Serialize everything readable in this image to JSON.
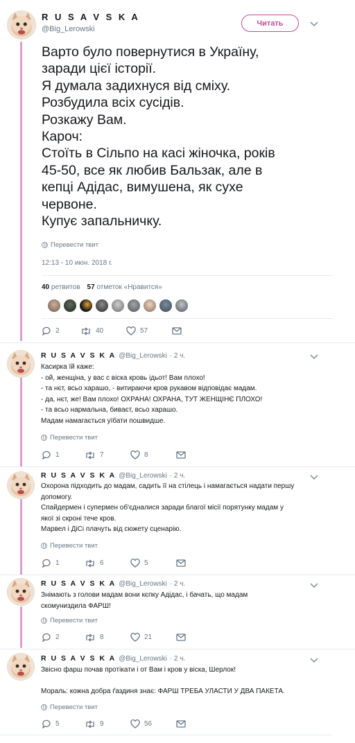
{
  "main": {
    "name": "R U S A V S K A",
    "handle": "@Big_Lerowski",
    "follow_label": "Читать",
    "lines": [
      "Варто було повернутися в Україну,",
      "заради цієї історії.",
      "Я думала задихнуся від сміху.",
      "Розбудила всіх сусідів.",
      "Розкажу Вам.",
      "Кароч:",
      "Стоїть в Сільпо на касі жіночка, років",
      "45-50, все як любив Бальзак, але в",
      "кепці Адідас, вимушена, як сухе",
      "червоне.",
      "Купує запальничку."
    ],
    "translate_label": "Перевести твит",
    "timestamp": "12:13 - 10 июн. 2018 г.",
    "retweets_count": "40",
    "retweets_label": "ретвитов",
    "likes_count": "57",
    "likes_label": "отметок «Нравится»",
    "reply_count": "2",
    "retweet_count": "40",
    "like_count": "57"
  },
  "replies": [
    {
      "name": "R U S A V S K A",
      "handle": "@Big_Lerowski",
      "time": "· 2 ч.",
      "lines": [
        "Касирка їй каже:",
        "- ой, женщіна, у вас с віска кровь ідьот! Вам плохо!",
        "- та нєт, всьо харашо, - витираючи кров рукавом відповідає мадам.",
        "- да, нєт, же! Вам плохо! ОХРАНА! ОХРАНА, ТУТ ЖЕНЩІНЄ ПЛОХО!",
        "- та всьо нармальна, биваєт, всьо харашо.",
        "Мадам намагається уїбати пошвидше."
      ],
      "translate_label": "Перевести твит",
      "reply_count": "1",
      "retweet_count": "7",
      "like_count": "8"
    },
    {
      "name": "R U S A V S K A",
      "handle": "@Big_Lerowski",
      "time": "· 2 ч.",
      "lines": [
        "Охорона підходить до мадам, садить її на стілець і намагається надати першу",
        "допомогу.",
        "Спайдермен і супермен об'єдналися заради благої місії порятунку мадам у",
        "якої зі скроні тече кров.",
        "Марвел і ДіСі плачуть від сюжету сценарію."
      ],
      "translate_label": "Перевести твит",
      "reply_count": "1",
      "retweet_count": "6",
      "like_count": "5"
    },
    {
      "name": "R U S A V S K A",
      "handle": "@Big_Lerowski",
      "time": "· 2 ч.",
      "lines": [
        "Знімають з голови мадам вони кєпку Адідас, і бачать, що мадам",
        "скомуниздила ФАРШ!"
      ],
      "translate_label": "Перевести твит",
      "reply_count": "2",
      "retweet_count": "8",
      "like_count": "21"
    },
    {
      "name": "R U S A V S K A",
      "handle": "@Big_Lerowski",
      "time": "· 2 ч.",
      "lines": [
        "Звісно фарш почав протікати і от Вам і кров у віска, Шерлок!",
        "",
        "Мораль: кожна добра ґаздиня знає: ФАРШ ТРЕБА УЛАСТИ У ДВА ПАКЕТА."
      ],
      "translate_label": "Перевести твит",
      "reply_count": "5",
      "retweet_count": "9",
      "like_count": "56"
    }
  ],
  "colors": {
    "accent": "#c14d9c",
    "thread_line": "#d9a0cf",
    "muted": "#657786"
  },
  "icons": [
    "reply-icon",
    "retweet-icon",
    "like-icon",
    "message-icon",
    "globe-icon",
    "chevron-down-icon"
  ]
}
